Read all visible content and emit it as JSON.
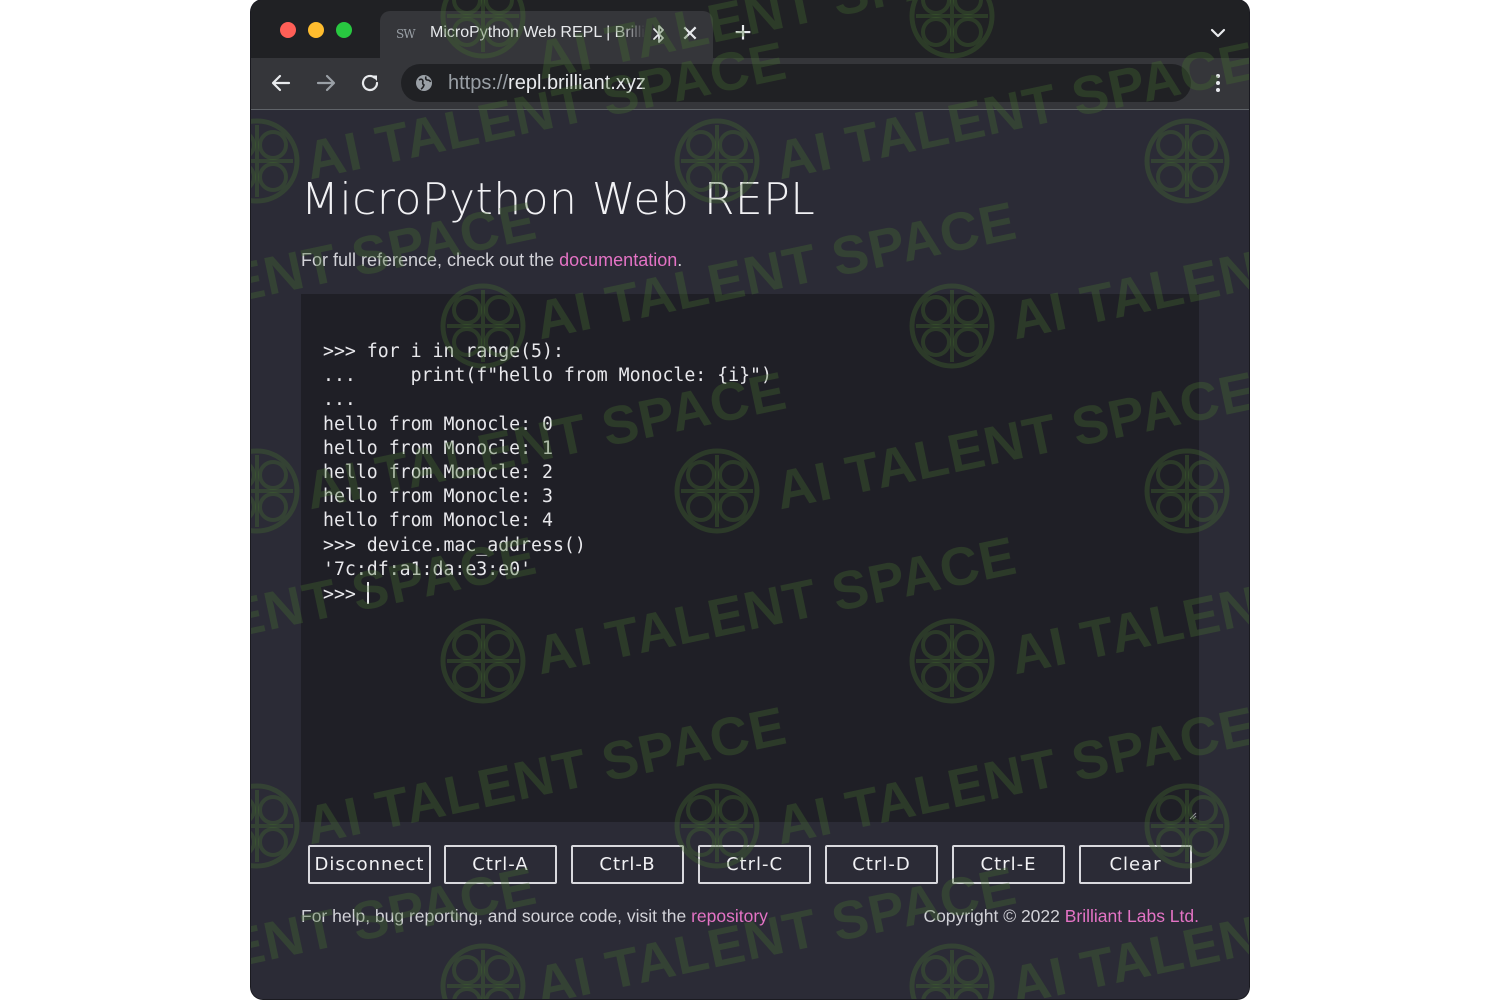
{
  "browser": {
    "tab": {
      "favicon_text": "SW",
      "title": "MicroPython Web REPL | Brilliant Labs",
      "close_glyph": "✕"
    },
    "new_tab_glyph": "+",
    "url": {
      "scheme": "https://",
      "host": "repl.brilliant.xyz"
    }
  },
  "page": {
    "title": "MicroPython Web REPL",
    "reference": {
      "prefix": "For full reference, check out the ",
      "link": "documentation",
      "suffix": "."
    },
    "terminal": {
      "lines": [
        ">>> for i in range(5):",
        "...     print(f\"hello from Monocle: {i}\")",
        "...",
        "hello from Monocle: 0",
        "hello from Monocle: 1",
        "hello from Monocle: 2",
        "hello from Monocle: 3",
        "hello from Monocle: 4",
        ">>> device.mac_address()",
        "'7c:df:a1:da:e3:e0'",
        ">>> "
      ]
    },
    "buttons": {
      "disconnect": "Disconnect",
      "ctrl_a": "Ctrl-A",
      "ctrl_b": "Ctrl-B",
      "ctrl_c": "Ctrl-C",
      "ctrl_d": "Ctrl-D",
      "ctrl_e": "Ctrl-E",
      "clear": "Clear"
    },
    "footer": {
      "help_prefix": "For help, bug reporting, and source code, visit the ",
      "help_link": "repository",
      "copyright_prefix": "Copyright © 2022 ",
      "copyright_link": "Brilliant Labs Ltd."
    }
  },
  "watermark": {
    "text": "AI TALENT SPACE"
  },
  "colors": {
    "page_bg": "#2b2b36",
    "terminal_bg": "#1f1f26",
    "link": "#e473c5",
    "browser_frame": "#202124",
    "toolbar": "#35363a"
  },
  "icons": {
    "back": "arrow-left-icon",
    "forward": "arrow-right-icon",
    "reload": "reload-icon",
    "site_info": "globe-icon",
    "menu": "kebab-menu-icon",
    "tab_audio": "bluetooth-icon",
    "tab_search": "chevron-down-icon"
  }
}
